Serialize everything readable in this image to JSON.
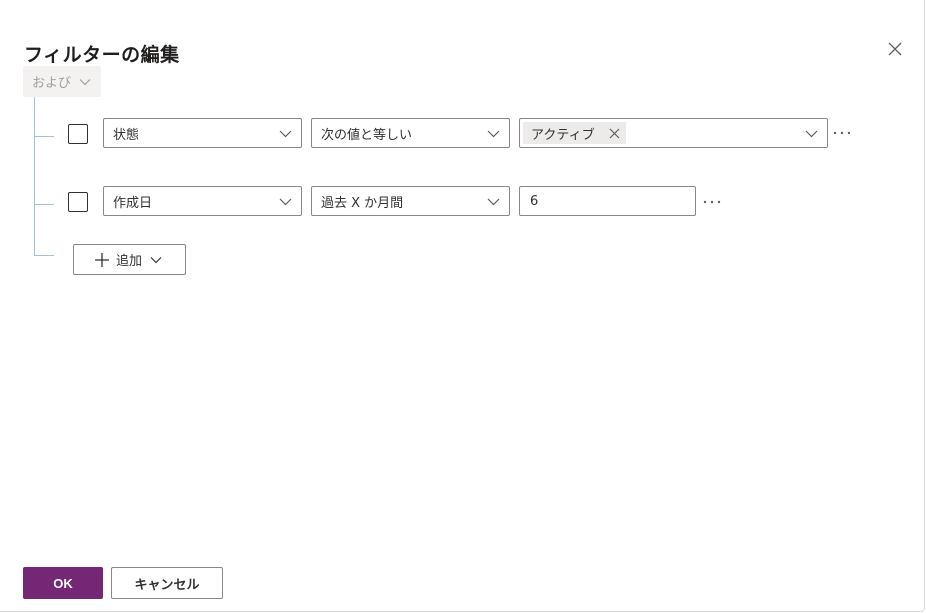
{
  "dialog": {
    "title": "フィルターの編集",
    "close_icon": "close-icon"
  },
  "group": {
    "operator_label": "および"
  },
  "rows": [
    {
      "field": "状態",
      "operator": "次の値と等しい",
      "value_tags": [
        "アクティブ"
      ],
      "more_icon": "more-options-icon"
    },
    {
      "field": "作成日",
      "operator": "過去 X か月間",
      "value": "6",
      "more_icon": "more-options-icon"
    }
  ],
  "add_button": {
    "label": "追加"
  },
  "footer": {
    "ok_label": "OK",
    "cancel_label": "キャンセル"
  },
  "colors": {
    "primary": "#742774",
    "tree_line": "#9fc5cf",
    "border": "#8a8886",
    "disabled_text": "#a19f9d"
  }
}
